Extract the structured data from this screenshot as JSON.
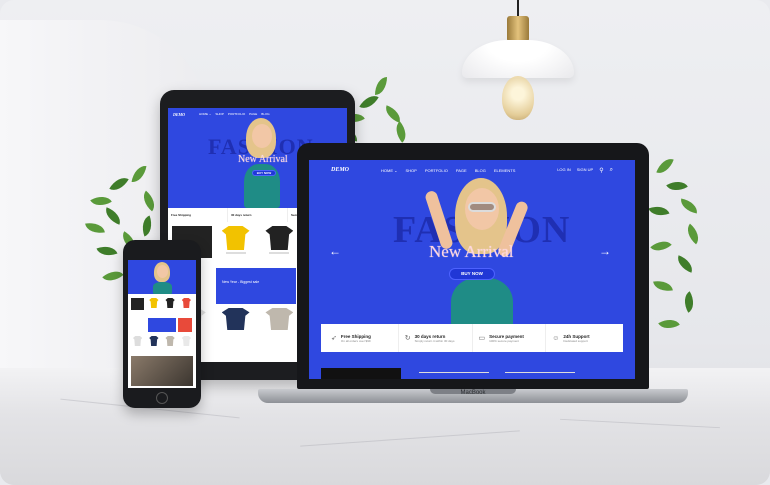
{
  "site": {
    "logo": "DEMO",
    "nav": [
      "HOME ⌄",
      "SHOP",
      "PORTFOLIO",
      "PAGE",
      "BLOG",
      "ELEMENTS"
    ],
    "nav_right": [
      "LOG IN",
      "SIGN UP"
    ],
    "hero_bg_word": "FASHION",
    "hero_title": "New Arrival",
    "hero_button": "BUY NOW",
    "accent_color": "#2f48e0"
  },
  "features": [
    {
      "title": "Free Shipping",
      "subtitle": "On all orders over $99",
      "icon": "rocket-icon"
    },
    {
      "title": "30 days return",
      "subtitle": "Simply return it within 30 days",
      "icon": "refresh-icon"
    },
    {
      "title": "Secure payment",
      "subtitle": "100% secure payment",
      "icon": "card-icon"
    },
    {
      "title": "24h Support",
      "subtitle": "Dedicated support",
      "icon": "user-icon"
    }
  ],
  "laptop_brand": "MacBook",
  "tablet_promo": "New Year - Biggest sale"
}
